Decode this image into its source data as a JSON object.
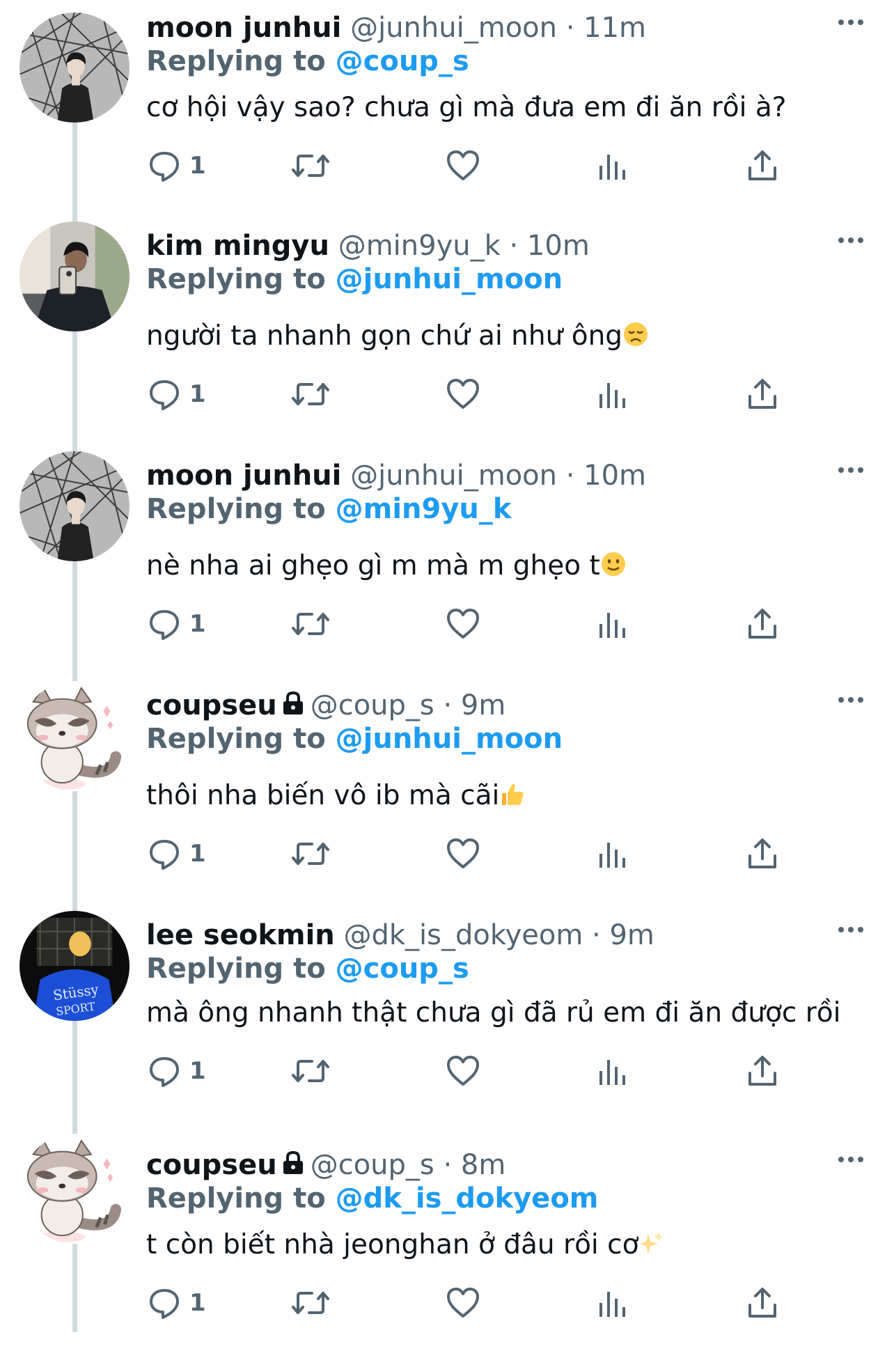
{
  "theme": {
    "accent": "#1d9bf0",
    "text_primary": "#0f1419",
    "text_secondary": "#536471",
    "thread_line": "#cfd9de"
  },
  "tweets": [
    {
      "name": "moon junhui",
      "handle": "@junhui_moon",
      "separator": "·",
      "time": "11m",
      "locked": false,
      "avatar": "avatar-junhui",
      "replying_prefix": "Replying to",
      "replying_to": "@coup_s",
      "text": "cơ hội vậy sao? chưa gì mà đưa em đi ăn rồi à?",
      "emoji": "",
      "reply_count": "1"
    },
    {
      "name": "kim mingyu",
      "handle": "@min9yu_k",
      "separator": "·",
      "time": "10m",
      "locked": false,
      "avatar": "avatar-mingyu",
      "replying_prefix": "Replying to",
      "replying_to": "@junhui_moon",
      "text": "người ta nhanh gọn chứ ai như ông",
      "emoji": "disappointed-face",
      "reply_count": "1"
    },
    {
      "name": "moon junhui",
      "handle": "@junhui_moon",
      "separator": "·",
      "time": "10m",
      "locked": false,
      "avatar": "avatar-junhui",
      "replying_prefix": "Replying to",
      "replying_to": "@min9yu_k",
      "text": "nè nha ai ghẹo gì m mà m ghẹo t",
      "emoji": "slightly-smiling-face",
      "reply_count": "1"
    },
    {
      "name": "coupseu",
      "handle": "@coup_s",
      "separator": "·",
      "time": "9m",
      "locked": true,
      "avatar": "avatar-raccoon",
      "replying_prefix": "Replying to",
      "replying_to": "@junhui_moon",
      "text": "thôi nha biến vô ib mà cãi",
      "emoji": "thumbs-up",
      "reply_count": "1"
    },
    {
      "name": "lee seokmin",
      "handle": "@dk_is_dokyeom",
      "separator": "·",
      "time": "9m",
      "locked": false,
      "avatar": "avatar-seokmin",
      "replying_prefix": "Replying to",
      "replying_to": "@coup_s",
      "text": "mà ông nhanh thật chưa gì đã rủ em đi ăn được rồi",
      "emoji": "",
      "reply_count": "1"
    },
    {
      "name": "coupseu",
      "handle": "@coup_s",
      "separator": "·",
      "time": "8m",
      "locked": true,
      "avatar": "avatar-raccoon",
      "replying_prefix": "Replying to",
      "replying_to": "@dk_is_dokyeom",
      "text": "t còn biết nhà jeonghan ở đâu rồi cơ",
      "emoji": "sparkles",
      "reply_count": "1"
    }
  ]
}
